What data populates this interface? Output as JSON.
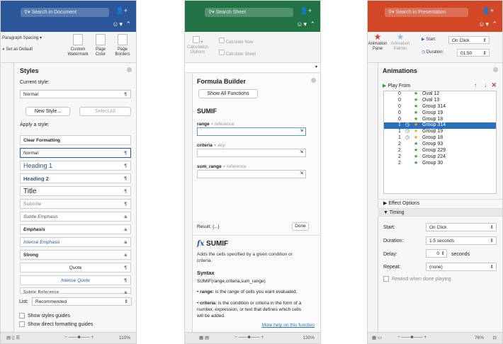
{
  "word": {
    "search_placeholder": "Search in Document",
    "ribbon": {
      "paragraph_spacing": "Paragraph Spacing",
      "set_as_default": "Set as Default",
      "custom_watermark": "Custom Watermark",
      "page_color": "Page Color",
      "page_borders": "Page Borders"
    },
    "pane": {
      "title": "Styles",
      "current_style_label": "Current style:",
      "current_style_value": "Normal",
      "new_style_button": "New Style...",
      "select_all_button": "Select All",
      "apply_label": "Apply a style:",
      "styles": [
        {
          "name": "Clear Formatting",
          "mark": ""
        },
        {
          "name": "Normal",
          "mark": "¶"
        },
        {
          "name": "Heading 1",
          "mark": "¶"
        },
        {
          "name": "Heading 2",
          "mark": "¶"
        },
        {
          "name": "Title",
          "mark": "¶"
        },
        {
          "name": "Subtitle",
          "mark": "¶"
        },
        {
          "name": "Subtle Emphasis",
          "mark": "a"
        },
        {
          "name": "Emphasis",
          "mark": "a"
        },
        {
          "name": "Intense Emphasis",
          "mark": "a"
        },
        {
          "name": "Strong",
          "mark": "a"
        },
        {
          "name": "Quote",
          "mark": "¶"
        },
        {
          "name": "Intense Quote",
          "mark": "¶"
        },
        {
          "name": "Subtle Reference",
          "mark": "a"
        }
      ],
      "list_label": "List:",
      "list_value": "Recommended",
      "show_styles_guides": "Show styles guides",
      "show_direct_formatting": "Show direct formatting guides"
    },
    "zoom": "110%"
  },
  "excel": {
    "search_placeholder": "Search Sheet",
    "ribbon": {
      "calculate_now": "Calculate Now",
      "calculation_options": "Calculation Options",
      "calculate_sheet": "Calculate Sheet"
    },
    "pane": {
      "title": "Formula Builder",
      "show_all_functions": "Show All Functions",
      "function_name": "SUMIF",
      "args": [
        {
          "name": "range",
          "type": "reference"
        },
        {
          "name": "criteria",
          "type": "any"
        },
        {
          "name": "sum_range",
          "type": "reference"
        }
      ],
      "result_label": "Result: {...}",
      "done_button": "Done",
      "fx_title": "SUMIF",
      "description": "Adds the cells specified by a given condition or criteria.",
      "syntax_heading": "Syntax",
      "syntax_fn": "SUMIF(range,criteria,sum_range)",
      "bullet_range_name": "range:",
      "bullet_range_text": "is the range of cells you want evaluated.",
      "bullet_criteria_name": "criteria:",
      "bullet_criteria_text": "is the condition or criteria in the form of a number, expression, or text that defines which cells will be added.",
      "more_help": "More help on this function"
    },
    "zoom": "130%"
  },
  "ppt": {
    "search_placeholder": "Search in Presentation",
    "ribbon": {
      "animation_pane": "Animation Pane",
      "animation_painter": "Animation Painter",
      "start_label": "Start:",
      "start_value": "On Click",
      "duration_label": "Duration:",
      "duration_value": "01.50"
    },
    "pane": {
      "title": "Animations",
      "play_from": "Play From",
      "rows": [
        {
          "num": "0",
          "icon": "green-star",
          "name": "Oval 12"
        },
        {
          "num": "0",
          "icon": "green-star",
          "name": "Oval 13"
        },
        {
          "num": "0",
          "icon": "green-star",
          "name": "Group 314"
        },
        {
          "num": "0",
          "icon": "green-star",
          "name": "Group 19"
        },
        {
          "num": "0",
          "icon": "green-star",
          "name": "Group 18"
        },
        {
          "num": "1",
          "icon": "yellow-star",
          "name": "Group 314",
          "selected": true
        },
        {
          "num": "1",
          "icon": "yellow-star",
          "name": "Group 19"
        },
        {
          "num": "1",
          "icon": "yellow-star",
          "name": "Group 18"
        },
        {
          "num": "2",
          "icon": "green-star",
          "name": "Group 93"
        },
        {
          "num": "2",
          "icon": "green-star",
          "name": "Group 229"
        },
        {
          "num": "2",
          "icon": "green-star",
          "name": "Group 224"
        },
        {
          "num": "2",
          "icon": "green-star",
          "name": "Group 30"
        }
      ],
      "effect_options": "Effect Options",
      "timing": "Timing",
      "start_label": "Start:",
      "start_value": "On Click",
      "duration_label": "Duration:",
      "duration_value": "1.5 seconds",
      "delay_label": "Delay:",
      "delay_value": "0",
      "delay_unit": "seconds",
      "repeat_label": "Repeat:",
      "repeat_value": "(none)",
      "rewind_label": "Rewind when done playing"
    },
    "zoom": "76%"
  },
  "colors": {
    "word": "#2b579a",
    "excel": "#217346",
    "ppt": "#d24726",
    "selection": "#2a6fbb"
  }
}
